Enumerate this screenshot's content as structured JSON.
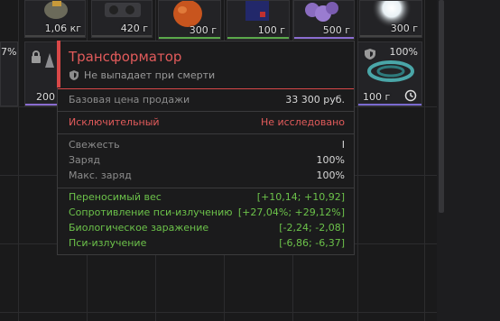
{
  "colors": {
    "accent_red": "#d94848",
    "positive_green": "#6cc24a",
    "background": "#1a1a1b",
    "tooltip_bg": "#1b1b1c"
  },
  "inventory": {
    "top_slots": [
      {
        "weight": "1,06 кг",
        "icon": "ammo-pouch-icon",
        "underline": "#444"
      },
      {
        "weight": "420 г",
        "icon": "gear-box-icon",
        "underline": "#444"
      },
      {
        "weight": "300 г",
        "icon": "orange-artifact-icon",
        "underline": "#5aa84a"
      },
      {
        "weight": "100 г",
        "icon": "device-icon",
        "underline": "#5aa84a"
      },
      {
        "weight": "500 г",
        "icon": "purple-artifact-icon",
        "underline": "#8a6cd0"
      },
      {
        "weight": "300 г",
        "icon": "glowing-orb-icon",
        "underline": "#444"
      }
    ],
    "left_slot": {
      "percent": "7%",
      "weight": "200"
    },
    "right_slot": {
      "percent": "100%",
      "weight": "100 г"
    }
  },
  "tooltip": {
    "title": "Трансформатор",
    "subtitle": "Не выпадает при смерти",
    "base_price_label": "Базовая цена продажи",
    "base_price_value": "33 300 руб.",
    "rarity_label": "Исключительный",
    "research_status": "Не исследовано",
    "stats": [
      {
        "label": "Свежесть",
        "value": "I"
      },
      {
        "label": "Заряд",
        "value": "100%"
      },
      {
        "label": "Макс. заряд",
        "value": "100%"
      }
    ],
    "effects": [
      {
        "label": "Переносимый вес",
        "value": "[+10,14; +10,92]"
      },
      {
        "label": "Сопротивление пси-излучению",
        "value": "[+27,04%; +29,12%]"
      },
      {
        "label": "Биологическое заражение",
        "value": "[-2,24; -2,08]"
      },
      {
        "label": "Пси-излучение",
        "value": "[-6,86; -6,37]"
      }
    ]
  }
}
